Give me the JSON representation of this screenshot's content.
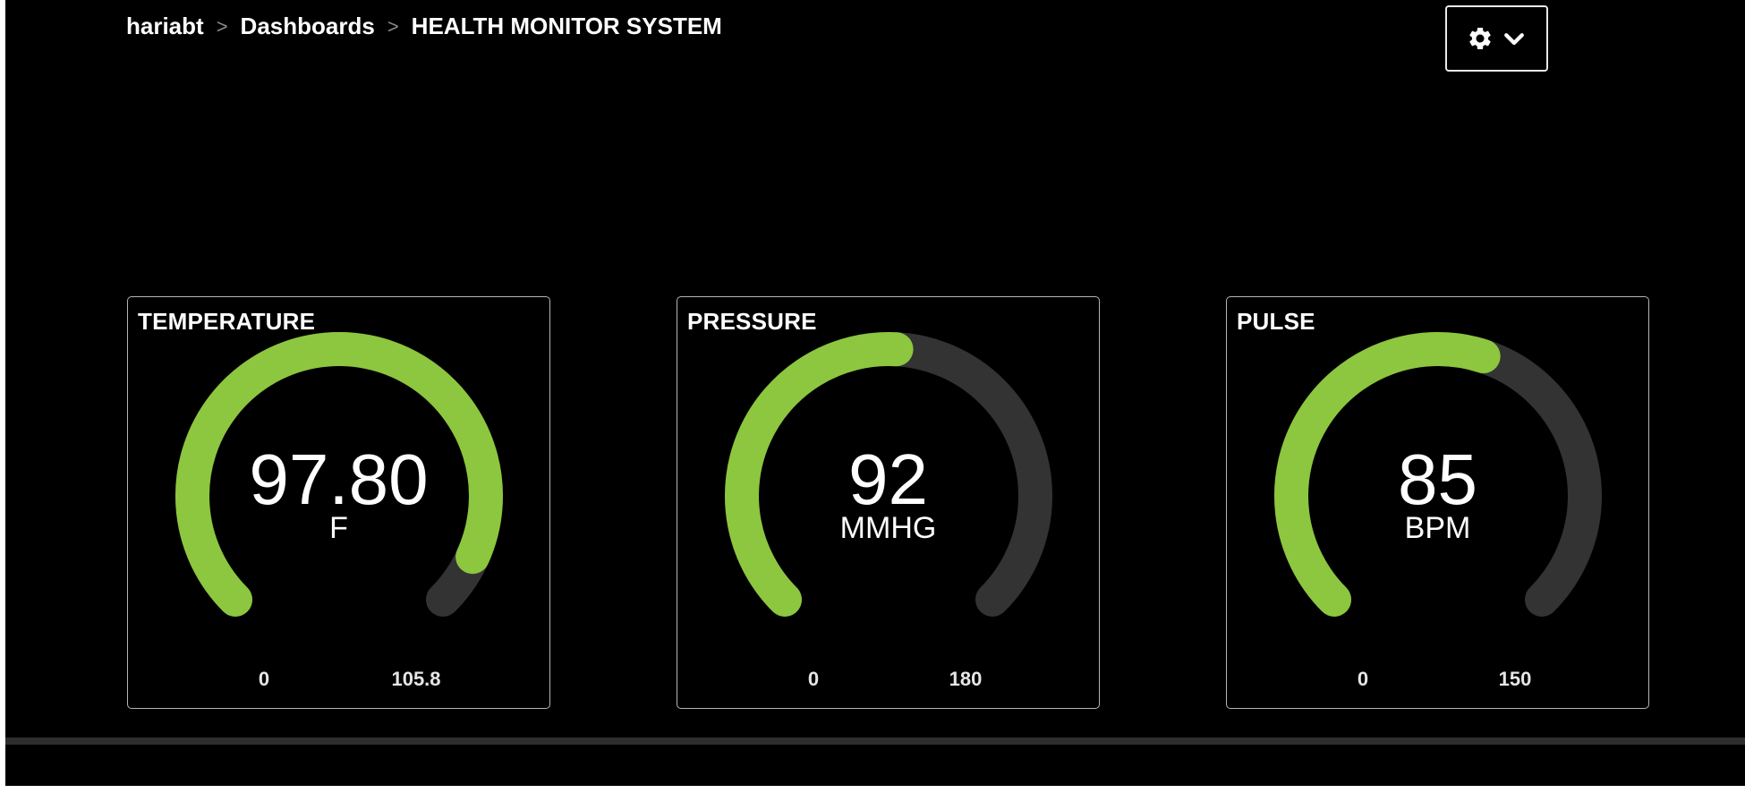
{
  "breadcrumb": {
    "items": [
      "hariabt",
      "Dashboards",
      "HEALTH MONITOR SYSTEM"
    ],
    "separator": ">"
  },
  "settings_button": {
    "icons": [
      "gear-icon",
      "chevron-down-icon"
    ]
  },
  "colors": {
    "background": "#000000",
    "gauge_fill": "#8dc63f",
    "gauge_track": "#333333",
    "text": "#ffffff",
    "card_border": "#b5b5b5"
  },
  "gauges": [
    {
      "title": "TEMPERATURE",
      "value": "97.80",
      "unit": "F",
      "min": "0",
      "max": "105.8"
    },
    {
      "title": "PRESSURE",
      "value": "92",
      "unit": "MMHG",
      "min": "0",
      "max": "180"
    },
    {
      "title": "PULSE",
      "value": "85",
      "unit": "BPM",
      "min": "0",
      "max": "150"
    }
  ]
}
